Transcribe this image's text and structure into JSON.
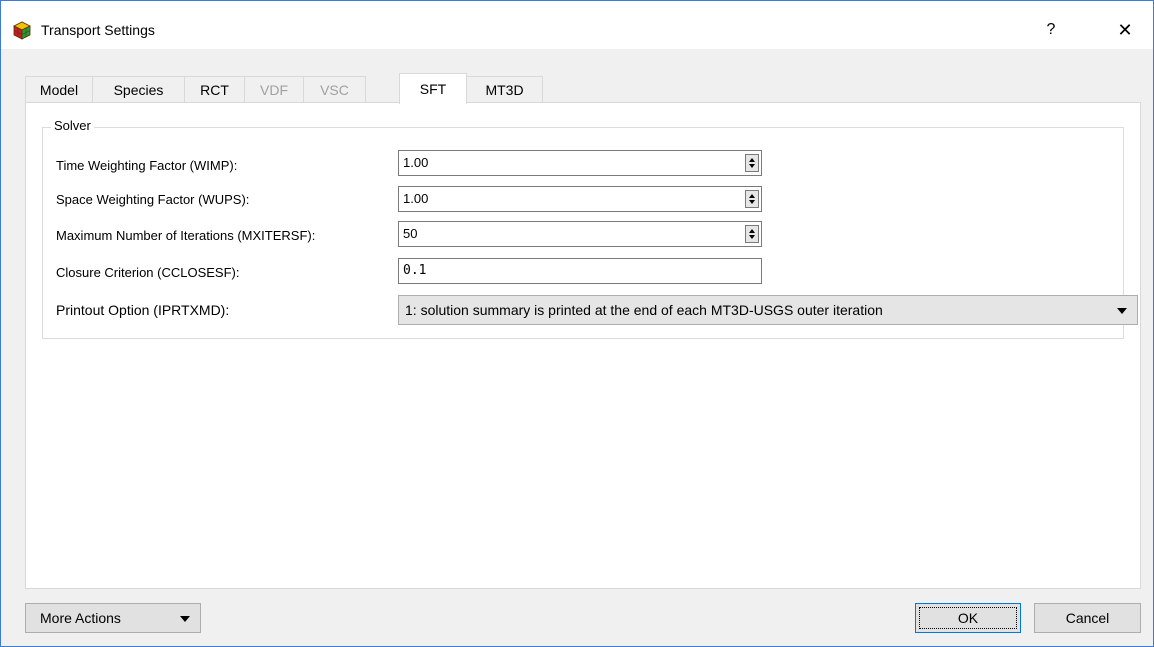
{
  "window": {
    "title": "Transport Settings",
    "help_label": "?",
    "close_label": "✕"
  },
  "tabs": [
    {
      "label": "Model",
      "state": "normal"
    },
    {
      "label": "Species",
      "state": "normal"
    },
    {
      "label": "RCT",
      "state": "normal"
    },
    {
      "label": "VDF",
      "state": "disabled"
    },
    {
      "label": "VSC",
      "state": "disabled"
    },
    {
      "label": "SFT",
      "state": "active"
    },
    {
      "label": "MT3D",
      "state": "normal"
    }
  ],
  "solver": {
    "group_title": "Solver",
    "fields": [
      {
        "label": "Time Weighting Factor (WIMP):",
        "value": "1.00"
      },
      {
        "label": "Space Weighting Factor (WUPS):",
        "value": "1.00"
      },
      {
        "label": "Maximum Number of Iterations (MXITERSF):",
        "value": "50"
      },
      {
        "label": "Closure Criterion (CCLOSESF):",
        "value": "0.1"
      }
    ],
    "printout": {
      "label": "Printout Option (IPRTXMD):",
      "selected": "1: solution summary is printed at the end of each MT3D-USGS outer iteration"
    }
  },
  "footer": {
    "more_actions_label": "More Actions",
    "ok_label": "OK",
    "cancel_label": "Cancel"
  }
}
